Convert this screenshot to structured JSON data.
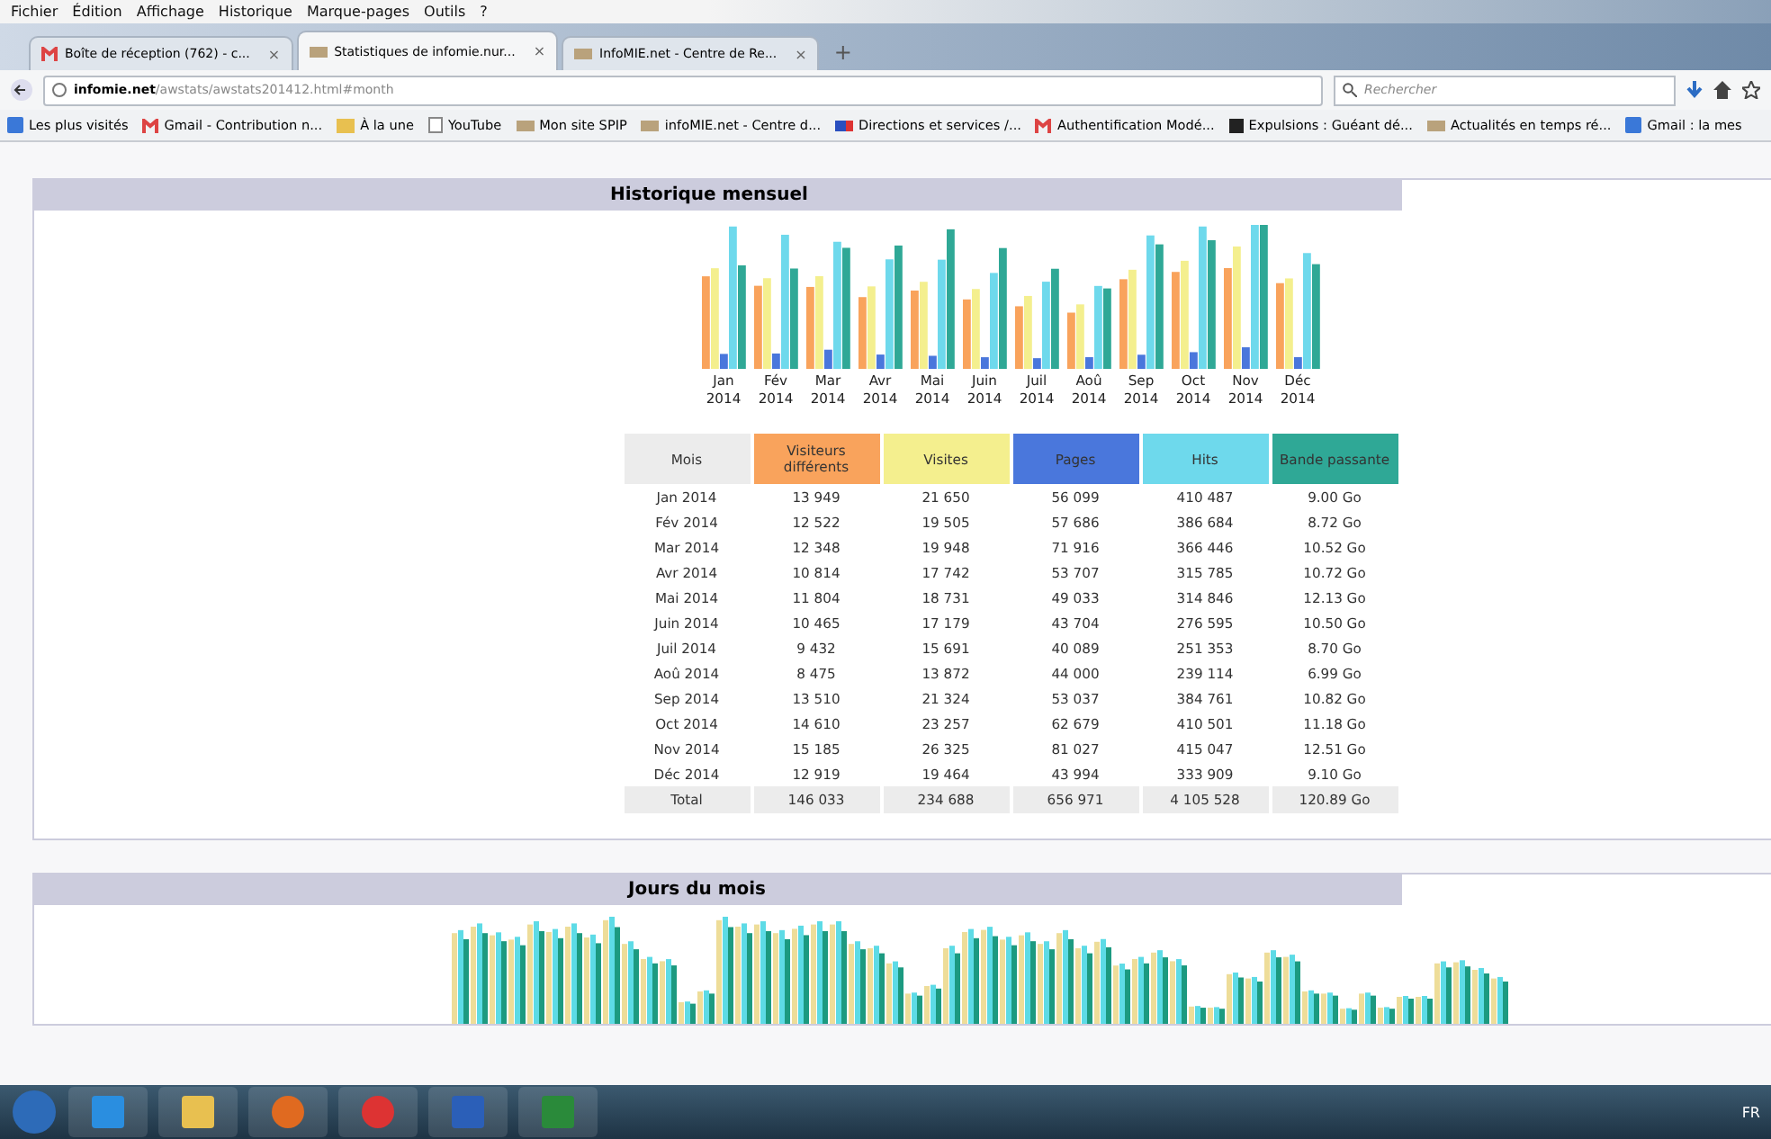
{
  "menu_bar": [
    "Fichier",
    "Édition",
    "Affichage",
    "Historique",
    "Marque-pages",
    "Outils",
    "?"
  ],
  "tabs": [
    {
      "label": "Boîte de réception (762) - c...",
      "selected": false,
      "kind": "mail",
      "close": "×"
    },
    {
      "label": "Statistiques de infomie.nur...",
      "selected": true,
      "kind": "site",
      "close": "×"
    },
    {
      "label": "InfoMIE.net - Centre de Re...",
      "selected": false,
      "kind": "site",
      "close": "×"
    }
  ],
  "new_tab": "+",
  "address_bar": {
    "domain": "infomie.net",
    "path": "/awstats/awstats201412.html#month",
    "search_placeholder": "Rechercher"
  },
  "bookmarks": [
    {
      "label": "Les plus visités",
      "kind": "book"
    },
    {
      "label": "Gmail - Contribution n...",
      "kind": "mail"
    },
    {
      "label": "À la une",
      "kind": "folder"
    },
    {
      "label": "YouTube",
      "kind": "page"
    },
    {
      "label": "Mon site SPIP",
      "kind": "site"
    },
    {
      "label": "infoMIE.net - Centre d...",
      "kind": "site"
    },
    {
      "label": "Directions et services /...",
      "kind": "flag"
    },
    {
      "label": "Authentification Modé...",
      "kind": "mail"
    },
    {
      "label": "Expulsions : Guéant dé...",
      "kind": "square"
    },
    {
      "label": "Actualités en temps ré...",
      "kind": "site"
    },
    {
      "label": "Gmail : la mes",
      "kind": "book"
    }
  ],
  "monthly": {
    "title": "Historique mensuel",
    "chart_labels": [
      {
        "month": "Jan",
        "year": "2014"
      },
      {
        "month": "Fév",
        "year": "2014"
      },
      {
        "month": "Mar",
        "year": "2014"
      },
      {
        "month": "Avr",
        "year": "2014"
      },
      {
        "month": "Mai",
        "year": "2014"
      },
      {
        "month": "Juin",
        "year": "2014"
      },
      {
        "month": "Juil",
        "year": "2014"
      },
      {
        "month": "Aoû",
        "year": "2014"
      },
      {
        "month": "Sep",
        "year": "2014"
      },
      {
        "month": "Oct",
        "year": "2014"
      },
      {
        "month": "Nov",
        "year": "2014"
      },
      {
        "month": "Déc",
        "year": "2014"
      }
    ],
    "columns": [
      {
        "label": "Mois",
        "color": "#ececec"
      },
      {
        "label": "Visiteurs différents",
        "color": "#f9a35c"
      },
      {
        "label": "Visites",
        "color": "#f4ef8e"
      },
      {
        "label": "Pages",
        "color": "#4a77dc"
      },
      {
        "label": "Hits",
        "color": "#6ed9ec"
      },
      {
        "label": "Bande passante",
        "color": "#2fa896"
      }
    ],
    "rows": [
      [
        "Jan 2014",
        "13 949",
        "21 650",
        "56 099",
        "410 487",
        "9.00 Go"
      ],
      [
        "Fév 2014",
        "12 522",
        "19 505",
        "57 686",
        "386 684",
        "8.72 Go"
      ],
      [
        "Mar 2014",
        "12 348",
        "19 948",
        "71 916",
        "366 446",
        "10.52 Go"
      ],
      [
        "Avr 2014",
        "10 814",
        "17 742",
        "53 707",
        "315 785",
        "10.72 Go"
      ],
      [
        "Mai 2014",
        "11 804",
        "18 731",
        "49 033",
        "314 846",
        "12.13 Go"
      ],
      [
        "Juin 2014",
        "10 465",
        "17 179",
        "43 704",
        "276 595",
        "10.50 Go"
      ],
      [
        "Juil 2014",
        "9 432",
        "15 691",
        "40 089",
        "251 353",
        "8.70 Go"
      ],
      [
        "Aoû 2014",
        "8 475",
        "13 872",
        "44 000",
        "239 114",
        "6.99 Go"
      ],
      [
        "Sep 2014",
        "13 510",
        "21 324",
        "53 037",
        "384 761",
        "10.82 Go"
      ],
      [
        "Oct 2014",
        "14 610",
        "23 257",
        "62 679",
        "410 501",
        "11.18 Go"
      ],
      [
        "Nov 2014",
        "15 185",
        "26 325",
        "81 027",
        "415 047",
        "12.51 Go"
      ],
      [
        "Déc 2014",
        "12 919",
        "19 464",
        "43 994",
        "333 909",
        "9.10 Go"
      ]
    ],
    "total": [
      "Total",
      "146 033",
      "234 688",
      "656 971",
      "4 105 528",
      "120.89 Go"
    ]
  },
  "daily": {
    "title": "Jours du mois"
  },
  "taskbar": {
    "language": "FR"
  }
}
